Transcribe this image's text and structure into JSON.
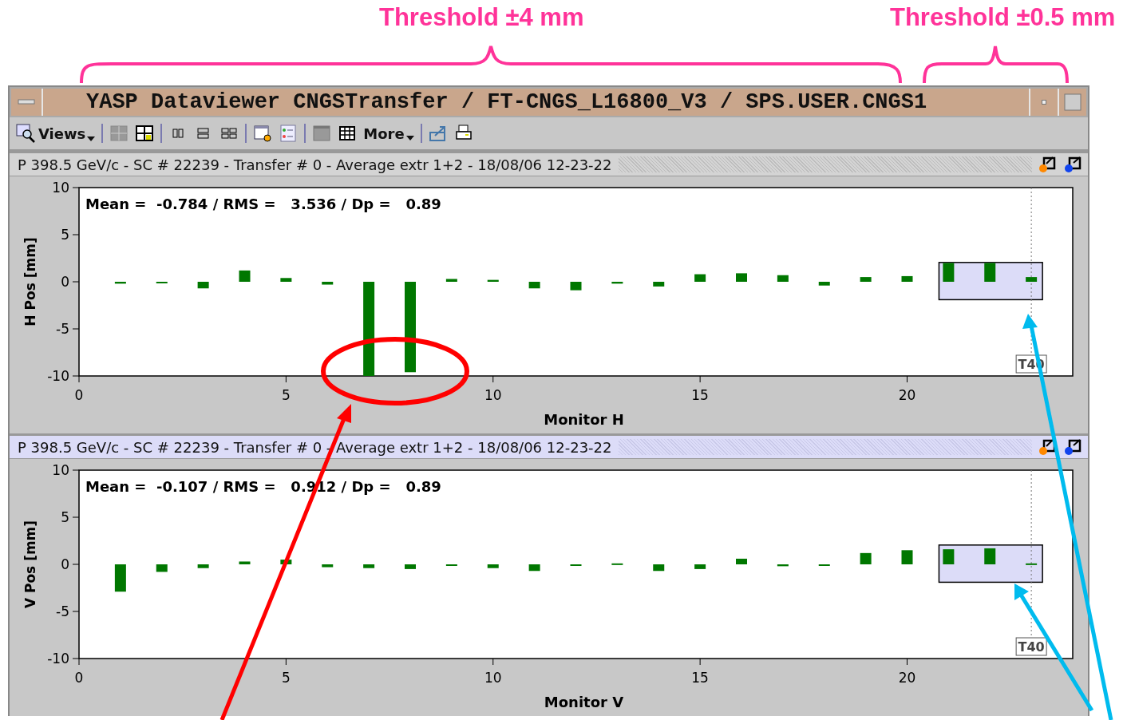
{
  "annotations": {
    "threshold_labels": [
      "Threshold ±4 mm",
      "Threshold ±0.5 mm"
    ]
  },
  "window": {
    "title": "YASP Dataviewer CNGSTransfer / FT-CNGS_L16800_V3 / SPS.USER.CNGS1"
  },
  "toolbar": {
    "views_label": "Views",
    "more_label": "More"
  },
  "panels": [
    {
      "header": "P 398.5 GeV/c - SC # 22239 - Transfer # 0 - Average extr 1+2 - 18/08/06 12-23-22",
      "selected": false,
      "stats": "Mean =  -0.784 / RMS =   3.536 / Dp =   0.89",
      "chart_data": {
        "type": "bar",
        "xlabel": "Monitor H",
        "ylabel": "H Pos [mm]",
        "x": [
          1,
          2,
          3,
          4,
          5,
          6,
          7,
          8,
          9,
          10,
          11,
          12,
          13,
          14,
          15,
          16,
          17,
          18,
          19,
          20,
          21,
          22,
          23
        ],
        "series": [
          {
            "color": "#007700",
            "values": [
              -0.2,
              -0.1,
              -0.7,
              1.2,
              0.4,
              -0.3,
              -10,
              -9.6,
              0.3,
              0.2,
              -0.7,
              -0.9,
              -0.2,
              -0.5,
              0.8,
              0.9,
              0.7,
              -0.4,
              0.5,
              0.6,
              2.0,
              2.0,
              0.5
            ]
          }
        ],
        "xlim": [
          0,
          24
        ],
        "ylim": [
          -10,
          10
        ],
        "xticks": [
          0,
          5,
          10,
          15,
          20
        ],
        "yticks": [
          -10,
          -5,
          0,
          5,
          10
        ],
        "ref_lines": [
          {
            "axis": "x",
            "value": 23,
            "label": "T40"
          }
        ]
      }
    },
    {
      "header": "P 398.5 GeV/c - SC # 22239 - Transfer # 0 - Average extr 1+2 - 18/08/06 12-23-22",
      "selected": true,
      "stats": "Mean =  -0.107 / RMS =   0.912 / Dp =   0.89",
      "chart_data": {
        "type": "bar",
        "xlabel": "Monitor V",
        "ylabel": "V Pos [mm]",
        "x": [
          1,
          2,
          3,
          4,
          5,
          6,
          7,
          8,
          9,
          10,
          11,
          12,
          13,
          14,
          15,
          16,
          17,
          18,
          19,
          20,
          21,
          22,
          23
        ],
        "series": [
          {
            "color": "#007700",
            "values": [
              -2.9,
              -0.8,
              -0.4,
              0.3,
              0.5,
              -0.3,
              -0.4,
              -0.5,
              -0.1,
              -0.4,
              -0.7,
              -0.1,
              0.1,
              -0.7,
              -0.5,
              0.6,
              -0.2,
              -0.1,
              1.2,
              1.5,
              1.6,
              1.7,
              0.1
            ]
          }
        ],
        "xlim": [
          0,
          24
        ],
        "ylim": [
          -10,
          10
        ],
        "xticks": [
          0,
          5,
          10,
          15,
          20
        ],
        "yticks": [
          -10,
          -5,
          0,
          5,
          10
        ],
        "ref_lines": [
          {
            "axis": "x",
            "value": 23,
            "label": "T40"
          }
        ]
      }
    }
  ]
}
